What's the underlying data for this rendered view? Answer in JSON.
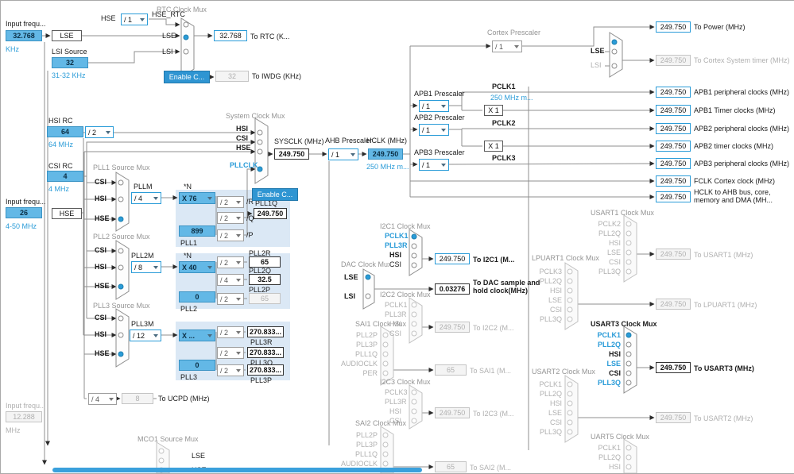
{
  "inputs": {
    "lse": {
      "label": "Input frequ...",
      "value": "32.768",
      "unit": "KHz"
    },
    "hse": {
      "label": "Input frequ...",
      "value": "26",
      "unit": "4-50 MHz"
    },
    "i2s": {
      "label": "Input frequ...",
      "value": "12.288",
      "unit": "MHz"
    }
  },
  "osc": {
    "lse_box": "LSE",
    "lsi_label": "LSI Source",
    "lsi_value": "32",
    "lsi_range": "31-32 KHz",
    "hsi_label": "HSI RC",
    "hsi_value": "64",
    "hsi_sub": "64 MHz",
    "hsi_div": "/ 2",
    "csi_label": "CSI RC",
    "csi_value": "4",
    "csi_sub": "4 MHz",
    "hse_box": "HSE"
  },
  "rtc": {
    "title": "RTC Clock Mux",
    "hse": "HSE",
    "hse_div": "/ 1",
    "hse_rtc": "HSE_RTC",
    "lse": "LSE",
    "lsi": "LSI",
    "out_value": "32.768",
    "out_label": "To RTC (K...",
    "enable": "Enable C...",
    "iwdg_value": "32",
    "iwdg_label": "To IWDG (KHz)"
  },
  "sysmux": {
    "title": "System Clock Mux",
    "inputs": [
      "HSI",
      "CSI",
      "HSE",
      "PLLCLK"
    ],
    "sysclk_label": "SYSCLK (MHz)",
    "sysclk_value": "249.750",
    "enable": "Enable C..."
  },
  "ahb": {
    "title": "AHB Prescaler",
    "div": "/ 1",
    "hclk_label": "HCLK (MHz)",
    "hclk_value": "249.750",
    "hclk_note": "250 MHz m..."
  },
  "cortex": {
    "title": "Cortex Prescaler",
    "div": "/ 1",
    "lse": "LSE",
    "lsi": "LSI"
  },
  "apb1": {
    "title": "APB1 Prescaler",
    "div": "/ 1",
    "pclk": "PCLK1",
    "note": "250 MHz m...",
    "x1": "X 1"
  },
  "apb2": {
    "title": "APB2 Prescaler",
    "div": "/ 1",
    "pclk": "PCLK2",
    "x1": "X 1"
  },
  "apb3": {
    "title": "APB3 Prescaler",
    "div": "/ 1",
    "pclk": "PCLK3"
  },
  "right_outputs": [
    {
      "value": "249.750",
      "label": "To Power (MHz)"
    },
    {
      "value": "249.750",
      "label": "To Cortex System timer (MHz)"
    },
    {
      "value": "249.750",
      "label": "APB1 peripheral clocks (MHz)"
    },
    {
      "value": "249.750",
      "label": "APB1 Timer clocks (MHz)"
    },
    {
      "value": "249.750",
      "label": "APB2 peripheral clocks (MHz)"
    },
    {
      "value": "249.750",
      "label": "APB2 timer clocks (MHz)"
    },
    {
      "value": "249.750",
      "label": "APB3 peripheral clocks (MHz)"
    },
    {
      "value": "249.750",
      "label": "FCLK Cortex clock (MHz)"
    },
    {
      "value": "249.750",
      "label": "HCLK to AHB bus, core, memory and DMA (MH..."
    }
  ],
  "pll1": {
    "title": "PLL1 Source Mux",
    "inputs": [
      "CSI",
      "HSI",
      "HSE"
    ],
    "m_label": "PLLM",
    "m": "/ 4",
    "n_label": "*N",
    "n": "X 76",
    "frac": "899",
    "name": "PLL1",
    "r": "/ 2",
    "r_label": "/R",
    "q": "/ 2",
    "q_label": "/Q",
    "p": "/ 2",
    "p_label": "/P",
    "q_out_label": "PLL1Q",
    "q_out": "249.750"
  },
  "pll2": {
    "title": "PLL2 Source Mux",
    "inputs": [
      "CSI",
      "HSI",
      "HSE"
    ],
    "m_label": "PLL2M",
    "m": "/ 8",
    "n_label": "*N",
    "n": "X 40",
    "frac": "0",
    "name": "PLL2",
    "r": "/ 2",
    "r_out_label": "PLL2R",
    "r_out": "65",
    "q": "/ 4",
    "q_out_label": "PLL2Q",
    "q_out": "32.5",
    "p": "/ 2",
    "p_out_label": "PLL2P",
    "p_out": "65"
  },
  "pll3": {
    "title": "PLL3 Source Mux",
    "inputs": [
      "CSI",
      "HSI",
      "HSE"
    ],
    "m_label": "PLL3M",
    "m": "/ 12",
    "n": "X ...",
    "frac": "0",
    "name": "PLL3",
    "r": "/ 2",
    "r_out": "270.833...",
    "r_out_label": "PLL3R",
    "q": "/ 2",
    "q_out": "270.833...",
    "q_out_label": "PLL3Q",
    "p": "/ 2",
    "p_out": "270.833...",
    "p_out_label": "PLL3P"
  },
  "ucpd": {
    "div": "/ 4",
    "value": "8",
    "label": "To UCPD (MHz)"
  },
  "mco": {
    "title": "MCO1 Source Mux",
    "lse": "LSE",
    "hse": "HSE"
  },
  "i2c1": {
    "title": "I2C1 Clock Mux",
    "inputs": [
      "PCLK1",
      "PLL3R",
      "HSI",
      "CSI"
    ],
    "value": "249.750",
    "label": "To I2C1 (M..."
  },
  "dac": {
    "title": "DAC Clock Mux",
    "lse": "LSE",
    "lsi": "LSI",
    "value": "0.03276",
    "label": "To DAC sample and hold clock(MHz)"
  },
  "i2c2": {
    "title": "I2C2 Clock Mux",
    "inputs": [
      "PCLK1",
      "PLL3R",
      "HSI",
      "CSI"
    ],
    "value": "249.750",
    "label": "To I2C2 (M..."
  },
  "sai1": {
    "title": "SAI1 Clock Mux",
    "inputs": [
      "PLL2P",
      "PLL3P",
      "PLL1Q",
      "AUDIOCLK",
      "PER"
    ],
    "value": "65",
    "label": "To SAI1 (M..."
  },
  "i2c3": {
    "title": "I2C3 Clock Mux",
    "inputs": [
      "PCLK3",
      "PLL3R",
      "HSI",
      "CSI"
    ],
    "value": "249.750",
    "label": "To I2C3 (M..."
  },
  "sai2": {
    "title": "SAI2 Clock Mux",
    "inputs": [
      "PLL2P",
      "PLL3P",
      "PLL1Q",
      "AUDIOCLK"
    ],
    "value": "65",
    "label": "To SAI2 (M..."
  },
  "usart1": {
    "title": "USART1 Clock Mux",
    "inputs": [
      "PCLK2",
      "PLL2Q",
      "HSI",
      "LSE",
      "CSI",
      "PLL3Q"
    ],
    "value": "249.750",
    "label": "To USART1 (MHz)"
  },
  "lpuart1": {
    "title": "LPUART1 Clock Mux",
    "inputs": [
      "PCLK3",
      "PLL2Q",
      "HSI",
      "LSE",
      "CSI",
      "PLL3Q"
    ],
    "value": "249.750",
    "label": "To LPUART1 (MHz)"
  },
  "usart3": {
    "title": "USART3 Clock Mux",
    "inputs": [
      "PCLK1",
      "PLL2Q",
      "HSI",
      "LSE",
      "CSI",
      "PLL3Q"
    ],
    "value": "249.750",
    "label": "To USART3 (MHz)"
  },
  "usart2": {
    "title": "USART2 Clock Mux",
    "inputs": [
      "PCLK1",
      "PLL2Q",
      "HSI",
      "LSE",
      "CSI",
      "PLL3Q"
    ],
    "value": "249.750",
    "label": "To USART2 (MHz)"
  },
  "uart5": {
    "title": "UART5 Clock Mux",
    "inputs": [
      "PCLK1",
      "PLL2Q",
      "HSI"
    ]
  }
}
